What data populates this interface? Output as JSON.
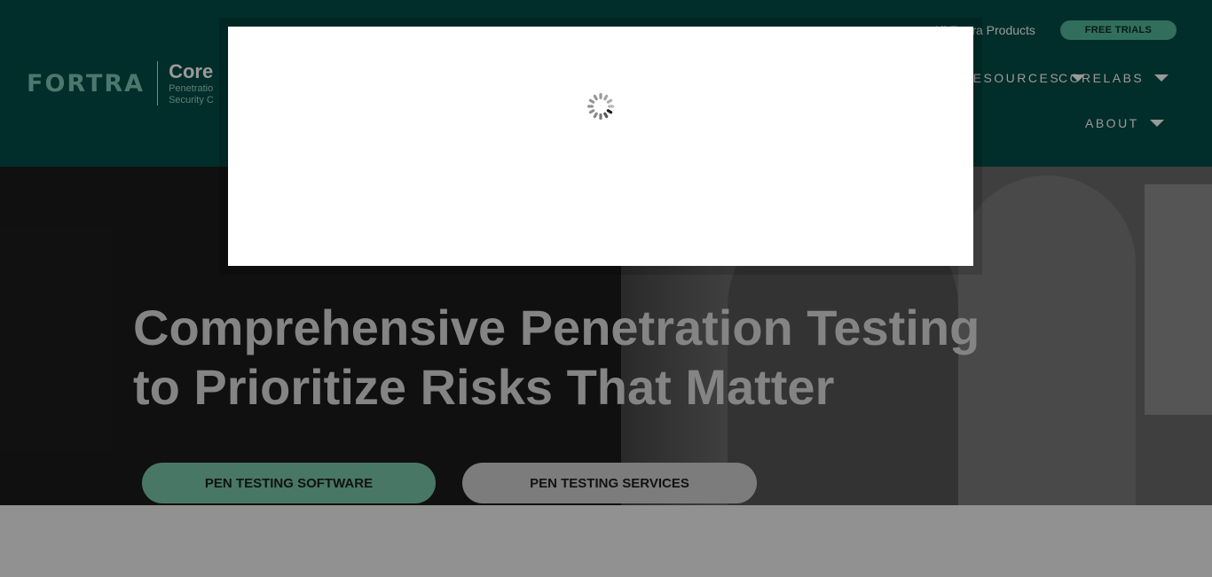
{
  "header": {
    "logo": {
      "brand": "FORTRA",
      "product": "Core",
      "tagline_lines": [
        "Penetratio",
        "Security C"
      ]
    },
    "utility": {
      "all_products": "All Fortra Products",
      "free_trials": "FREE TRIALS"
    },
    "nav": {
      "resources": "RESOURCES",
      "corelabs": "CORELABS",
      "about": "ABOUT"
    }
  },
  "hero": {
    "headline": "Comprehensive Penetration Testing to Prioritize Risks That Matter",
    "primary_button": "PEN TESTING SOFTWARE",
    "secondary_button": "PEN TESTING SERVICES"
  },
  "modal": {
    "state": "loading",
    "spinner_icon": "loading-spinner-icon"
  },
  "colors": {
    "header_bg": "#034b46",
    "accent": "#52b89a",
    "button_primary": "#78c6a9",
    "button_secondary": "#cfcfcf"
  }
}
